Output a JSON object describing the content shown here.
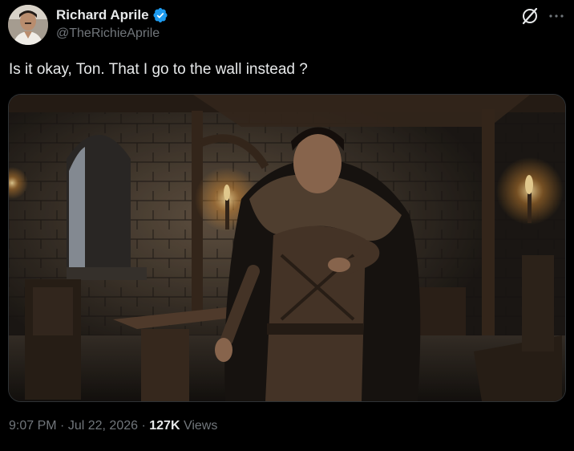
{
  "author": {
    "display_name": "Richard Aprile",
    "handle": "@TheRichieAprile",
    "verified": true,
    "avatar_icon": "profile-photo"
  },
  "header": {
    "grok_icon": "grok-slash-circle-icon",
    "more_icon": "more-horizontal-icon"
  },
  "tweet": {
    "text": "Is it okay, Ton. That I go to the wall instead ?"
  },
  "media": {
    "type": "image",
    "icon": "photo-medieval-hall"
  },
  "meta": {
    "time": "9:07 PM",
    "separator": "·",
    "date": "Jul 22, 2026",
    "views_count": "127K",
    "views_label": "Views"
  },
  "colors": {
    "background": "#000000",
    "primary_text": "#e7e9ea",
    "secondary_text": "#71767b",
    "verified_blue": "#1d9bf0",
    "border": "#2f3336"
  }
}
